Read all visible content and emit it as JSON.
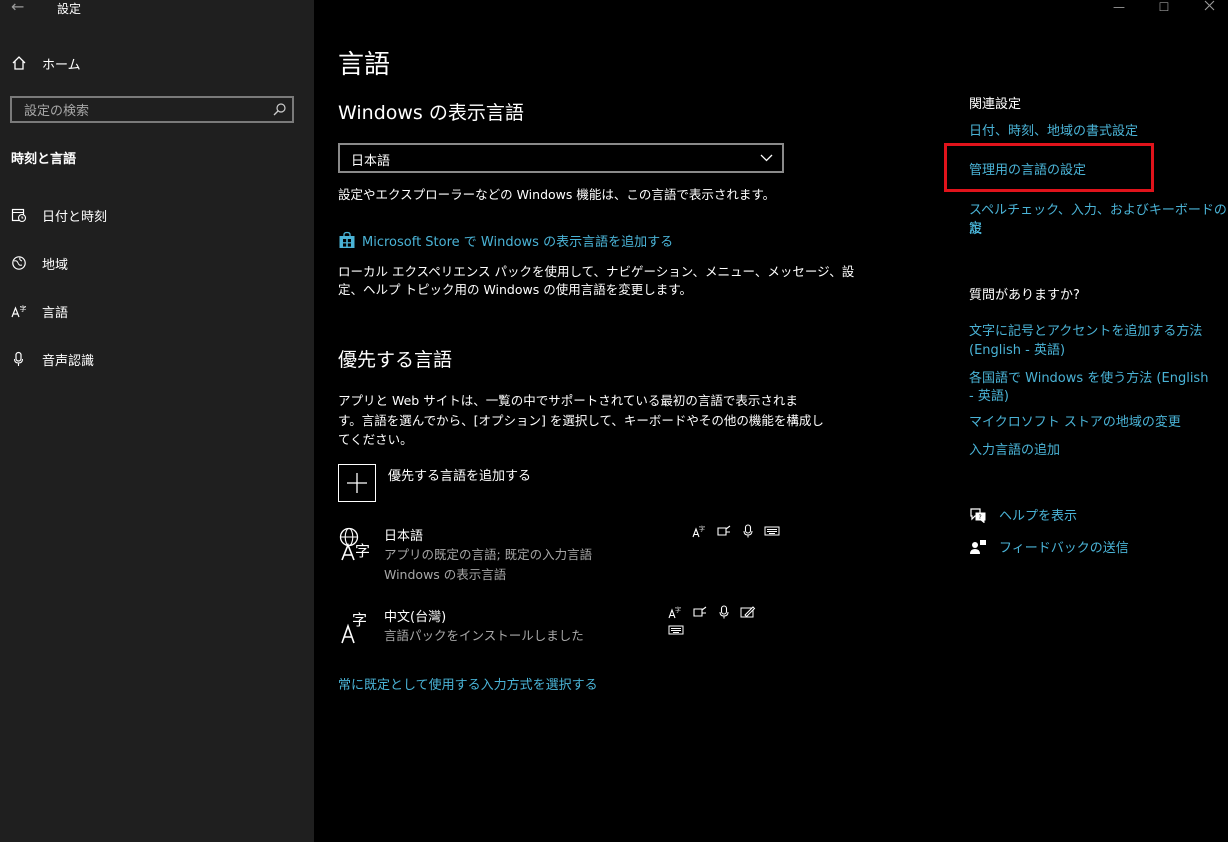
{
  "window": {
    "title": "設定",
    "back_glyph": "←",
    "minimize_glyph": "—",
    "maximize_glyph": "☐"
  },
  "sidebar": {
    "home_label": "ホーム",
    "search_placeholder": "設定の検索",
    "section_title": "時刻と言語",
    "items": [
      {
        "label": "日付と時刻",
        "icon": "date-time-icon"
      },
      {
        "label": "地域",
        "icon": "globe-icon"
      },
      {
        "label": "言語",
        "icon": "language-icon"
      },
      {
        "label": "音声認識",
        "icon": "microphone-icon"
      }
    ]
  },
  "main": {
    "page_title": "言語",
    "display_language": {
      "heading": "Windows の表示言語",
      "selected": "日本語",
      "description": "設定やエクスプローラーなどの Windows 機能は、この言語で表示されます。",
      "store_link": "Microsoft Store で Windows の表示言語を追加する",
      "store_desc_line1": "ローカル エクスペリエンス パックを使用して、ナビゲーション、メニュー、メッセージ、設",
      "store_desc_line2": "定、ヘルプ トピック用の Windows の使用言語を変更します。"
    },
    "preferred": {
      "heading": "優先する言語",
      "desc_line1": "アプリと Web サイトは、一覧の中でサポートされている最初の言語で表示されま",
      "desc_line2": "す。言語を選んでから、[オプション] を選択して、キーボードやその他の機能を構成し",
      "desc_line3": "てください。",
      "add_label": "優先する言語を追加する",
      "languages": [
        {
          "name": "日本語",
          "line1": "アプリの既定の言語; 既定の入力言語",
          "line2": "Windows の表示言語",
          "features": [
            "display-language-icon",
            "speech-icon",
            "voice-icon",
            "keyboard-icon"
          ]
        },
        {
          "name": "中文(台灣)",
          "line1": "言語パックをインストールしました",
          "features": [
            "display-language-icon",
            "speech-icon",
            "voice-icon",
            "handwriting-icon",
            "keyboard-icon"
          ]
        }
      ],
      "input_method_link": "常に既定として使用する入力方式を選択する"
    }
  },
  "right": {
    "related_heading": "関連設定",
    "related_links": [
      "日付、時刻、地域の書式設定",
      "管理用の言語の設定",
      "スペルチェック、入力、およびキーボードの設",
      "定"
    ],
    "questions_heading": "質問がありますか?",
    "question_links": [
      "文字に記号とアクセントを追加する方法",
      "(English - 英語)",
      "各国語で Windows を使う方法 (English",
      "- 英語)",
      "マイクロソフト ストアの地域の変更",
      "入力言語の追加"
    ],
    "help_label": "ヘルプを表示",
    "feedback_label": "フィードバックの送信"
  },
  "colors": {
    "accent_link": "#4ab3d6",
    "highlight_box": "#e0131b",
    "sidebar_bg": "#1f1f1f",
    "main_bg": "#000000"
  }
}
